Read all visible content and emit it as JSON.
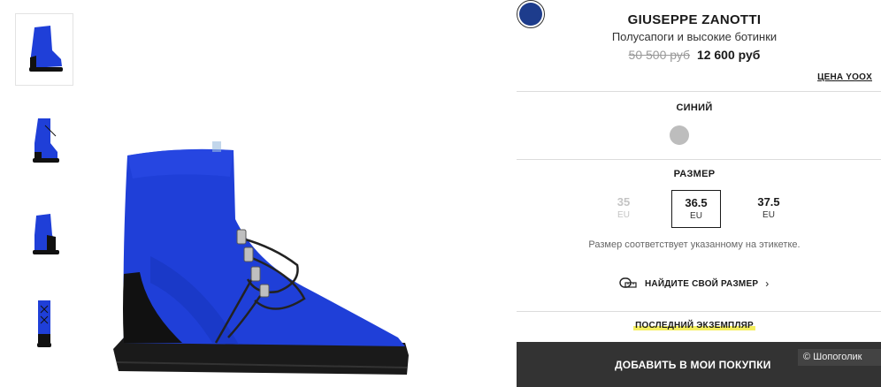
{
  "product": {
    "brand": "GIUSEPPE ZANOTTI",
    "category": "Полусапоги и высокие ботинки",
    "old_price": "50 500 руб",
    "new_price": "12 600 руб",
    "yoox_price_link": "ЦЕНА YOOX"
  },
  "color": {
    "label": "СИНИЙ",
    "options": [
      {
        "name": "grey-swatch",
        "hex": "#bdbdbd",
        "selected": false
      },
      {
        "name": "blue-swatch",
        "hex": "#1d3c8c",
        "selected": true
      }
    ]
  },
  "size": {
    "label": "РАЗМЕР",
    "options": [
      {
        "value": "35",
        "unit": "EU",
        "state": "unavailable"
      },
      {
        "value": "36.5",
        "unit": "EU",
        "state": "selected"
      },
      {
        "value": "37.5",
        "unit": "EU",
        "state": "available"
      }
    ],
    "note": "Размер соответствует указанному на этикетке.",
    "find_size": "НАЙДИТЕ СВОЙ РАЗМЕР"
  },
  "stock": {
    "last_copy": "ПОСЛЕДНИЙ ЭКЗЕМПЛЯР"
  },
  "cta": {
    "add_to_cart": "ДОБАВИТЬ В МОИ ПОКУПКИ"
  },
  "watermark": "© Шопоголик",
  "icons": {
    "ruler": "tape-measure-icon",
    "chevron": "chevron-right-icon"
  },
  "colors": {
    "boot_blue": "#1f3fd8",
    "boot_black": "#111111",
    "button_bg": "#333333",
    "highlight": "#f5ef5e"
  }
}
